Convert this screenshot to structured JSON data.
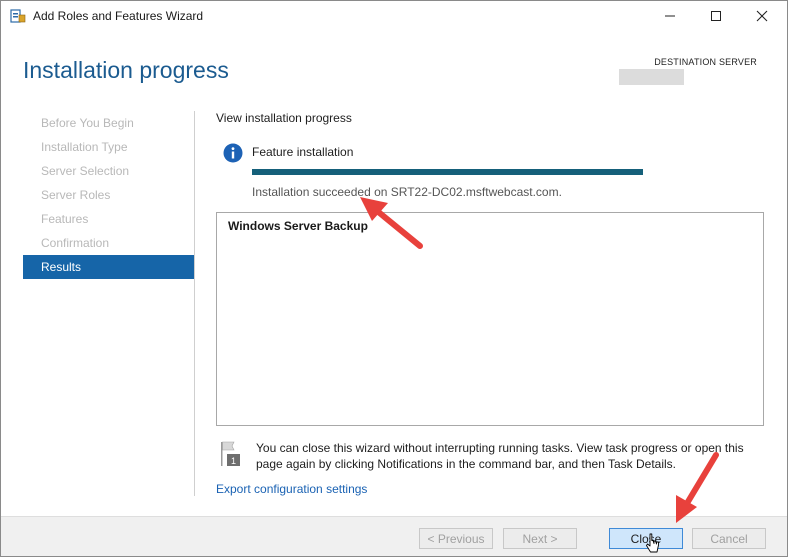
{
  "window": {
    "title": "Add Roles and Features Wizard",
    "icon": "server-manager-icon",
    "controls": [
      "minimize-icon",
      "maximize-icon",
      "close-icon"
    ]
  },
  "header": {
    "page_title": "Installation progress",
    "destination_label": "DESTINATION SERVER"
  },
  "nav": {
    "items": [
      {
        "label": "Before You Begin",
        "state": "disabled"
      },
      {
        "label": "Installation Type",
        "state": "disabled"
      },
      {
        "label": "Server Selection",
        "state": "disabled"
      },
      {
        "label": "Server Roles",
        "state": "disabled"
      },
      {
        "label": "Features",
        "state": "disabled"
      },
      {
        "label": "Confirmation",
        "state": "disabled"
      },
      {
        "label": "Results",
        "state": "active"
      }
    ]
  },
  "main": {
    "view_label": "View installation progress",
    "feature_label": "Feature installation",
    "progress_fraction": 1.0,
    "status_text": "Installation succeeded on SRT22-DC02.msftwebcast.com.",
    "results": [
      "Windows Server Backup"
    ],
    "note": "You can close this wizard without interrupting running tasks. View task progress or open this page again by clicking Notifications in the command bar, and then Task Details.",
    "note_flag_number": "1",
    "export_link": "Export configuration settings"
  },
  "footer": {
    "previous_label": "< Previous",
    "next_label": "Next >",
    "close_label": "Close",
    "cancel_label": "Cancel"
  },
  "colors": {
    "accent": "#1665a8",
    "title": "#1b5b90",
    "progress": "#15607a",
    "annotation_arrow": "#e8413c"
  }
}
